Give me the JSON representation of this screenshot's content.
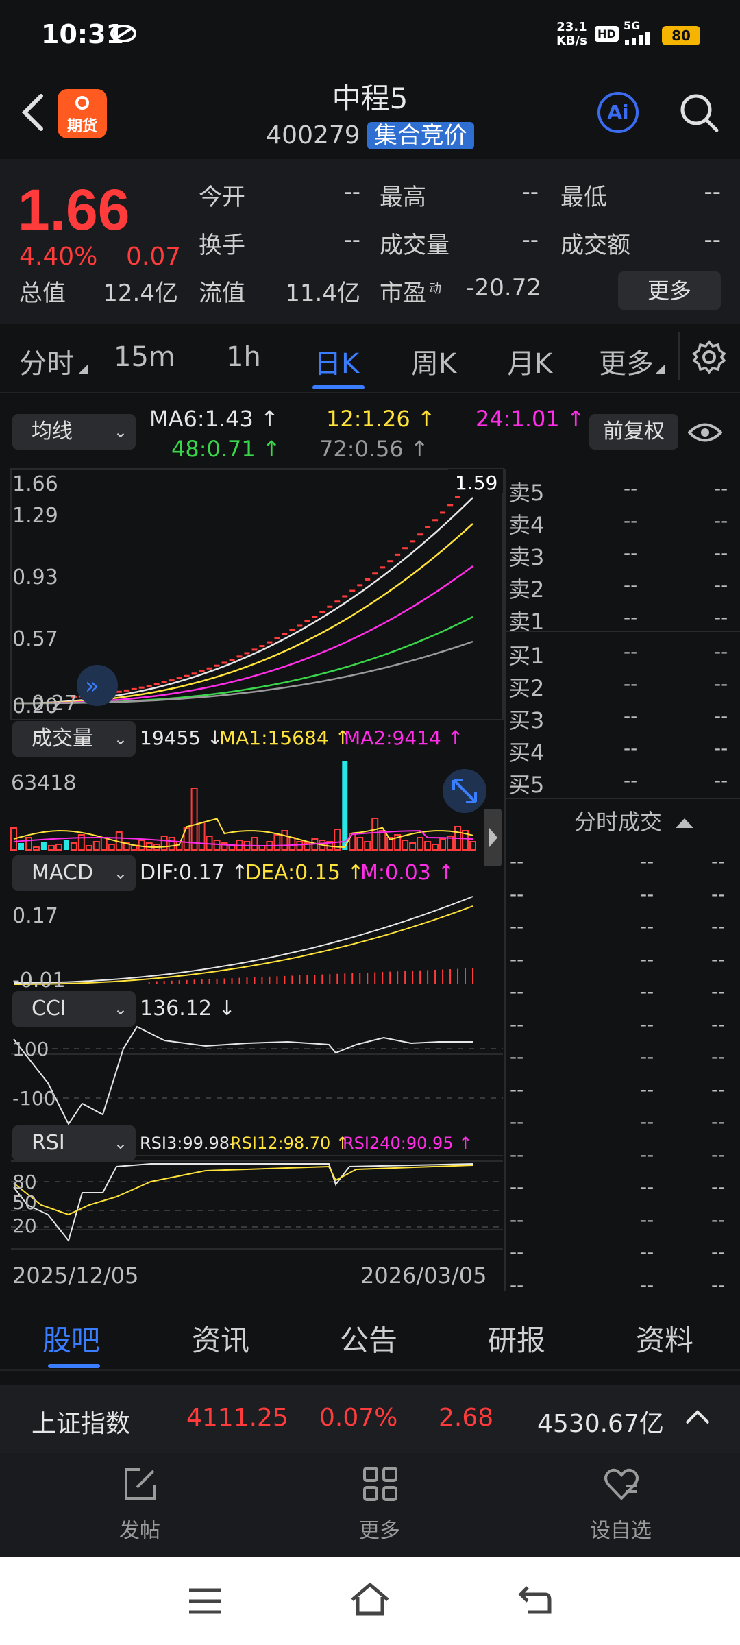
{
  "status": {
    "time": "10:31",
    "net_speed": "23.1",
    "net_unit": "KB/s",
    "hd": "HD",
    "signal": "5G",
    "battery": "80"
  },
  "header": {
    "logo_text": "期货",
    "title": "中程5",
    "code": "400279",
    "tag": "集合竞价",
    "ai_label": "Ai"
  },
  "quote": {
    "price": "1.66",
    "change_pct": "4.40%",
    "change": "0.07",
    "labels": {
      "open": "今开",
      "high": "最高",
      "low": "最低",
      "turnover": "换手",
      "volume": "成交量",
      "amount": "成交额",
      "total_value": "总值",
      "float_value": "流值",
      "pe": "市盈",
      "pe_sup": "动"
    },
    "values": {
      "open": "--",
      "high": "--",
      "low": "--",
      "turnover": "--",
      "volume": "--",
      "amount": "--",
      "total_value": "12.4亿",
      "float_value": "11.4亿",
      "pe": "-20.72"
    },
    "more": "更多"
  },
  "tabs": [
    "分时",
    "15m",
    "1h",
    "日K",
    "周K",
    "月K",
    "更多"
  ],
  "active_tab": "日K",
  "ma": {
    "selector": "均线",
    "ma6": "MA6:1.43",
    "ma12": "12:1.26",
    "ma24": "24:1.01",
    "ma48": "48:0.71",
    "ma72": "72:0.56",
    "adjust": "前复权",
    "colors": {
      "ma6": "#e6e6e6",
      "ma12": "#ffe23a",
      "ma24": "#ff2ee6",
      "ma48": "#3ad64a",
      "ma72": "#9a9a9a"
    }
  },
  "kline": {
    "y_labels": [
      "1.66",
      "1.29",
      "0.93",
      "0.57",
      "0.20",
      "0.27"
    ],
    "high_mark": "1.59"
  },
  "volume": {
    "selector": "成交量",
    "value": "19455",
    "ma1": "MA1:15684",
    "ma2": "MA2:9414",
    "y_label": "63418"
  },
  "macd": {
    "selector": "MACD",
    "dif": "DIF:0.17",
    "dea": "DEA:0.15",
    "m": "M:0.03",
    "y_labels": [
      "0.17",
      "-0.01"
    ]
  },
  "cci": {
    "selector": "CCI",
    "value": "136.12",
    "y_labels": [
      "100",
      "-100"
    ]
  },
  "rsi": {
    "selector": "RSI",
    "rsi3": "RSI3:99.98-",
    "rsi12": "RSI12:98.70",
    "rsi240": "RSI240:90.95",
    "y_labels": [
      "80",
      "50",
      "20"
    ]
  },
  "dates": {
    "start": "2025/12/05",
    "end": "2026/03/05"
  },
  "orderbook": {
    "asks": [
      "卖5",
      "卖4",
      "卖3",
      "卖2",
      "卖1"
    ],
    "bids": [
      "买1",
      "买2",
      "买3",
      "买4",
      "买5"
    ],
    "placeholder": "--",
    "trades_title": "分时成交"
  },
  "bottom_tabs": [
    "股吧",
    "资讯",
    "公告",
    "研报",
    "资料"
  ],
  "active_bottom_tab": "股吧",
  "index_bar": {
    "name": "上证指数",
    "value": "4111.25",
    "pct": "0.07%",
    "change": "2.68",
    "amount": "4530.67亿"
  },
  "actions": [
    "发帖",
    "更多",
    "设自选"
  ]
}
